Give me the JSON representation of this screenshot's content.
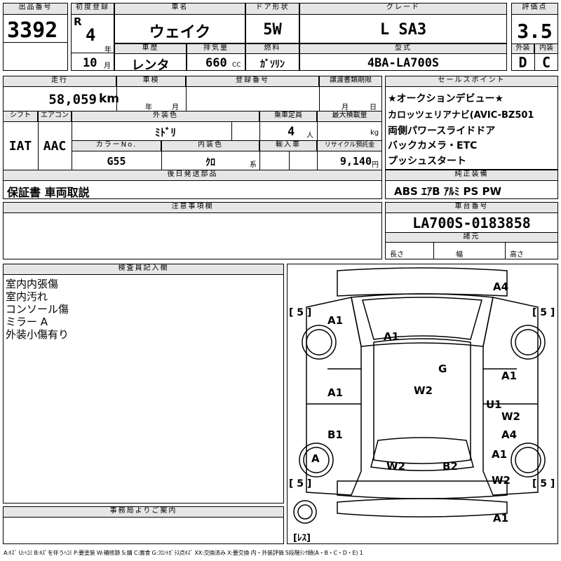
{
  "header": {
    "lot_label": "出品番号",
    "lot_no": "3392",
    "first_reg_label": "初度登録",
    "era": "R",
    "year": "4",
    "year_unit": "年",
    "month": "10",
    "month_unit": "月",
    "car_name_label": "車名",
    "car_name": "ウェイク",
    "door_label": "ドア形状",
    "door": "5W",
    "grade_label": "グレード",
    "grade": "L SA3",
    "score_label": "評価点",
    "score": "3.5",
    "exterior_label": "外装",
    "exterior": "D",
    "interior_label": "内装",
    "interior": "C",
    "history_label": "車歴",
    "history": "レンタ",
    "displacement_label": "排気量",
    "displacement": "660",
    "cc": "CC",
    "fuel_label": "燃料",
    "fuel": "ｶﾞｿﾘﾝ",
    "model_label": "型式",
    "model": "4BA-LA700S"
  },
  "row2": {
    "mileage_label": "走行",
    "mileage": "58,059",
    "km": "km",
    "inspection_label": "車検",
    "insp_year": "年",
    "insp_month": "月",
    "reg_no_label": "登録番号",
    "transfer_label": "譲渡書類期限",
    "transfer_month": "月",
    "transfer_day": "日",
    "shift_label": "シフト",
    "shift": "IAT",
    "ac_label": "エアコン",
    "ac": "AAC",
    "ext_color_label": "外装色",
    "ext_color": "ﾐﾄﾞﾘ",
    "capacity_label": "乗車定員",
    "capacity": "4",
    "capacity_unit": "人",
    "max_load_label": "最大積載量",
    "max_load_unit": "kg",
    "color_no_label": "カラーNo.",
    "color_no": "G55",
    "int_color_label": "内装色",
    "int_color": "ｸﾛ",
    "int_color_unit": "系",
    "import_label": "輸入車",
    "recycle_label": "リサイクル預託金",
    "recycle": "9,140",
    "recycle_unit": "円",
    "later_label": "後日発送部品",
    "later": "保証書 車両取説"
  },
  "sales": {
    "label": "セールスポイント",
    "lines": [
      "★オークションデビュー★",
      "カロッツェリアナビ(AVIC-BZ501",
      "両側パワースライドドア",
      "バックカメラ・ETC",
      "プッシュスタート"
    ]
  },
  "equipment": {
    "label": "純正装備",
    "value": "ABS ｴｱB ｱﾙﾐ PS PW"
  },
  "notes": {
    "label": "注意事項欄"
  },
  "chassis": {
    "label": "車台番号",
    "value": "LA700S-0183858",
    "dims_label": "諸元",
    "length": "長さ",
    "width": "幅",
    "height": "高さ"
  },
  "inspector": {
    "label": "検査員記入欄",
    "lines": [
      "室内内張傷",
      "室内汚れ",
      "コンソール傷",
      "ミラー A",
      "外装小傷有り"
    ]
  },
  "office": {
    "label": "事務局よりご案内"
  },
  "diagram": {
    "tire_tl": "[ 5 ]",
    "tire_tr": "[ 5 ]",
    "tire_bl": "[ 5 ]",
    "tire_br": "[ 5 ]",
    "spare": "[ﾚｽ]",
    "marks": [
      "A4",
      "A1",
      "A1",
      "G",
      "A1",
      "W2",
      "A1",
      "U1",
      "W2",
      "B1",
      "A4",
      "A1",
      "A",
      "W2",
      "B2",
      "W2",
      "A1"
    ]
  },
  "legend": "A:ｷｽﾞ U:ﾍｺﾐ B:ｷｽﾞを伴うﾍｺﾐ P:要塗装 W:補修跡 S:錆 C:腐食 G:ﾌﾛﾝﾄｶﾞﾗｽ点ｷｽﾞ XX:交換済み X:要交換 内・外装評価 5段階ﾗﾝｸ順(A・B・C・D・E) 1"
}
